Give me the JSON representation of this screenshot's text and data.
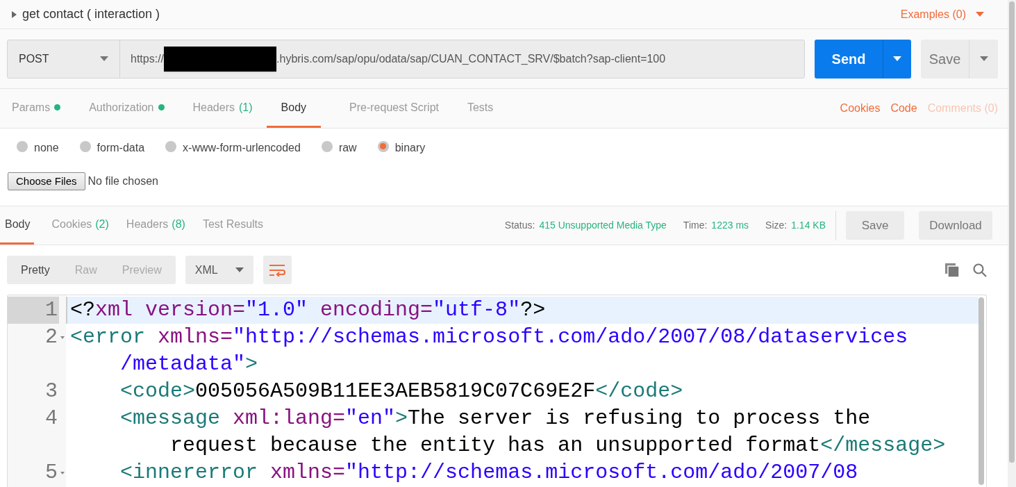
{
  "request": {
    "title": "get contact ( interaction )",
    "examples": "Examples (0)"
  },
  "url_bar": {
    "method": "POST",
    "url_prefix": "https://",
    "url_redacted": true,
    "url_suffix": ".hybris.com/sap/opu/odata/sap/CUAN_CONTACT_SRV/$batch?sap-client=100",
    "send": "Send",
    "save": "Save"
  },
  "request_tabs": [
    {
      "label": "Params",
      "dot": true,
      "selected": false
    },
    {
      "label": "Authorization",
      "dot": true,
      "selected": false
    },
    {
      "label": "Headers",
      "count": "(1)",
      "dot": false,
      "selected": false
    },
    {
      "label": "Body",
      "dot": false,
      "selected": true
    },
    {
      "label": "Pre-request Script",
      "dot": false,
      "selected": false
    },
    {
      "label": "Tests",
      "dot": false,
      "selected": false
    }
  ],
  "request_links": [
    {
      "label": "Cookies",
      "disabled": false
    },
    {
      "label": "Code",
      "disabled": false
    },
    {
      "label": "Comments (0)",
      "disabled": true
    }
  ],
  "body_types": [
    {
      "label": "none",
      "selected": false
    },
    {
      "label": "form-data",
      "selected": false
    },
    {
      "label": "x-www-form-urlencoded",
      "selected": false
    },
    {
      "label": "raw",
      "selected": false
    },
    {
      "label": "binary",
      "selected": true
    }
  ],
  "file_input": {
    "button": "Choose Files",
    "status": "No file chosen"
  },
  "response_tabs": [
    {
      "label": "Body",
      "selected": true
    },
    {
      "label": "Cookies",
      "count": "(2)",
      "selected": false
    },
    {
      "label": "Headers",
      "count": "(8)",
      "selected": false
    },
    {
      "label": "Test Results",
      "selected": false
    }
  ],
  "response_meta": [
    {
      "label": "Status:",
      "value": "415 Unsupported Media Type"
    },
    {
      "label": "Time:",
      "value": "1223 ms"
    },
    {
      "label": "Size:",
      "value": "1.14 KB"
    }
  ],
  "response_buttons": [
    "Save",
    "Download"
  ],
  "view_modes": [
    {
      "label": "Pretty",
      "selected": true
    },
    {
      "label": "Raw",
      "selected": false
    },
    {
      "label": "Preview",
      "selected": false
    }
  ],
  "format": "XML",
  "code": [
    {
      "number": "1",
      "foldable": false,
      "active": true,
      "nested": false,
      "rows": [
        {
          "segments": [
            {
              "kind": "punct",
              "text": "<?"
            },
            {
              "kind": "attr",
              "text": "xml version="
            },
            {
              "kind": "string",
              "text": "\"1.0\""
            },
            {
              "kind": "attr",
              "text": " encoding="
            },
            {
              "kind": "string",
              "text": "\"utf-8\""
            },
            {
              "kind": "punct",
              "text": "?>"
            }
          ]
        }
      ]
    },
    {
      "number": "2",
      "foldable": true,
      "active": false,
      "nested": false,
      "rows": [
        {
          "segments": [
            {
              "kind": "tag",
              "text": "<error"
            },
            {
              "kind": "attr",
              "text": " xmlns="
            },
            {
              "kind": "string",
              "text": "\"http://schemas.microsoft.com/ado/2007/08/dataservices"
            }
          ]
        },
        {
          "segments": [
            {
              "kind": "string",
              "text": "/metadata\""
            },
            {
              "kind": "tag",
              "text": ">"
            }
          ]
        }
      ]
    },
    {
      "number": "3",
      "foldable": false,
      "active": false,
      "nested": true,
      "rows": [
        {
          "segments": [
            {
              "kind": "tag",
              "text": "<code>"
            },
            {
              "kind": "text",
              "text": "005056A509B11EE3AEB5819C07C69E2F"
            },
            {
              "kind": "tag",
              "text": "</code>"
            }
          ]
        }
      ]
    },
    {
      "number": "4",
      "foldable": false,
      "active": false,
      "nested": true,
      "rows": [
        {
          "segments": [
            {
              "kind": "tag",
              "text": "<message"
            },
            {
              "kind": "attr",
              "text": " xml:lang="
            },
            {
              "kind": "string",
              "text": "\"en\""
            },
            {
              "kind": "tag",
              "text": ">"
            },
            {
              "kind": "text",
              "text": "The server is refusing to process the"
            }
          ]
        },
        {
          "segments": [
            {
              "kind": "text",
              "text": "request because the entity has an unsupported format"
            },
            {
              "kind": "tag",
              "text": "</message>"
            }
          ]
        }
      ]
    },
    {
      "number": "5",
      "foldable": true,
      "active": false,
      "nested": true,
      "rows": [
        {
          "segments": [
            {
              "kind": "tag",
              "text": "<innererror"
            },
            {
              "kind": "attr",
              "text": " xmlns="
            },
            {
              "kind": "string",
              "text": "\"http://schemas.microsoft.com/ado/2007/08"
            }
          ]
        }
      ]
    }
  ]
}
